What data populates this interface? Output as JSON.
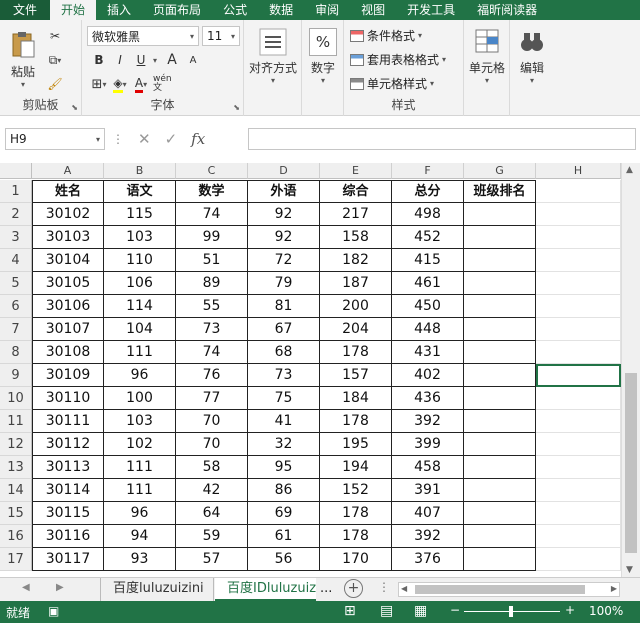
{
  "ribbon_tabs": [
    "文件",
    "开始",
    "插入",
    "页面布局",
    "公式",
    "数据",
    "审阅",
    "视图",
    "开发工具",
    "福昕阅读器"
  ],
  "clipboard": {
    "paste": "粘贴",
    "group": "剪贴板"
  },
  "font": {
    "name": "微软雅黑",
    "size": "11",
    "group": "字体",
    "bold": "B",
    "italic": "I",
    "underline": "U",
    "grow": "A",
    "shrink": "A",
    "wen": "wén\n文"
  },
  "alignment": {
    "label": "对齐方式"
  },
  "number": {
    "label": "数字",
    "symbol": "%"
  },
  "styles": {
    "conditional": "条件格式",
    "table": "套用表格格式",
    "cell": "单元格样式",
    "group": "样式"
  },
  "cells": {
    "label": "单元格"
  },
  "editing": {
    "label": "编辑"
  },
  "namebox": "H9",
  "formula": {
    "fx": "fx",
    "value": ""
  },
  "columns": [
    "A",
    "B",
    "C",
    "D",
    "E",
    "F",
    "G",
    "H"
  ],
  "headers": [
    "姓名",
    "语文",
    "数学",
    "外语",
    "综合",
    "总分",
    "班级排名"
  ],
  "rows": [
    [
      "30102",
      "115",
      "74",
      "92",
      "217",
      "498",
      ""
    ],
    [
      "30103",
      "103",
      "99",
      "92",
      "158",
      "452",
      ""
    ],
    [
      "30104",
      "110",
      "51",
      "72",
      "182",
      "415",
      ""
    ],
    [
      "30105",
      "106",
      "89",
      "79",
      "187",
      "461",
      ""
    ],
    [
      "30106",
      "114",
      "55",
      "81",
      "200",
      "450",
      ""
    ],
    [
      "30107",
      "104",
      "73",
      "67",
      "204",
      "448",
      ""
    ],
    [
      "30108",
      "111",
      "74",
      "68",
      "178",
      "431",
      ""
    ],
    [
      "30109",
      "96",
      "76",
      "73",
      "157",
      "402",
      ""
    ],
    [
      "30110",
      "100",
      "77",
      "75",
      "184",
      "436",
      ""
    ],
    [
      "30111",
      "103",
      "70",
      "41",
      "178",
      "392",
      ""
    ],
    [
      "30112",
      "102",
      "70",
      "32",
      "195",
      "399",
      ""
    ],
    [
      "30113",
      "111",
      "58",
      "95",
      "194",
      "458",
      ""
    ],
    [
      "30114",
      "111",
      "42",
      "86",
      "152",
      "391",
      ""
    ],
    [
      "30115",
      "96",
      "64",
      "69",
      "178",
      "407",
      ""
    ],
    [
      "30116",
      "94",
      "59",
      "61",
      "178",
      "392",
      ""
    ],
    [
      "30117",
      "93",
      "57",
      "56",
      "170",
      "376",
      ""
    ]
  ],
  "row_numbers": [
    "1",
    "2",
    "3",
    "4",
    "5",
    "6",
    "7",
    "8",
    "9",
    "10",
    "11",
    "12",
    "13",
    "14",
    "15",
    "16",
    "17"
  ],
  "sheets": [
    "百度luluzuizini",
    "百度IDluluzuizini"
  ],
  "sheet_more": "...",
  "status": {
    "mode": "就绪",
    "zoom": "100%"
  },
  "colors": {
    "accent": "#217346"
  }
}
